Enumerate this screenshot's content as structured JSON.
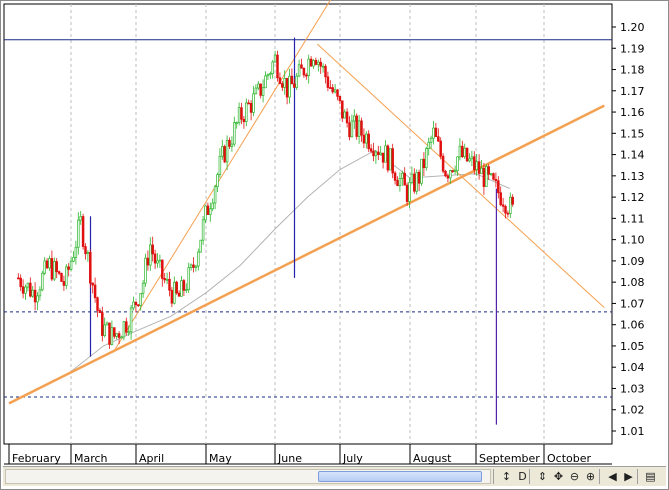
{
  "chart_data": {
    "type": "candlestick",
    "y_axis": {
      "position": "right",
      "min": 1.0,
      "max": 1.21,
      "tick_labels": [
        "1.20",
        "1.19",
        "1.18",
        "1.17",
        "1.16",
        "1.15",
        "1.14",
        "1.13",
        "1.12",
        "1.11",
        "1.10",
        "1.09",
        "1.08",
        "1.07",
        "1.06",
        "1.05",
        "1.04",
        "1.03",
        "1.02",
        "1.01"
      ]
    },
    "x_axis": {
      "months": [
        "February",
        "March",
        "April",
        "May",
        "June",
        "July",
        "August",
        "September",
        "October"
      ],
      "x_range_months": [
        0.15,
        9.0
      ]
    },
    "grid": "vertical dashed at month starts",
    "series": [
      {
        "kind": "price",
        "up_color": "#2ab52a",
        "down_color": "#e01010",
        "points": [
          {
            "t": 0.15,
            "c": 1.082
          },
          {
            "t": 0.4,
            "c": 1.075
          },
          {
            "t": 0.65,
            "c": 1.088
          },
          {
            "t": 0.9,
            "c": 1.079
          },
          {
            "t": 1.15,
            "c": 1.108
          },
          {
            "t": 1.3,
            "c": 1.085
          },
          {
            "t": 1.45,
            "c": 1.06
          },
          {
            "t": 1.65,
            "c": 1.054
          },
          {
            "t": 1.9,
            "c": 1.063
          },
          {
            "t": 2.1,
            "c": 1.08
          },
          {
            "t": 2.2,
            "c": 1.098
          },
          {
            "t": 2.3,
            "c": 1.087
          },
          {
            "t": 2.45,
            "c": 1.078
          },
          {
            "t": 2.6,
            "c": 1.072
          },
          {
            "t": 2.8,
            "c": 1.085
          },
          {
            "t": 3.0,
            "c": 1.112
          },
          {
            "t": 3.25,
            "c": 1.14
          },
          {
            "t": 3.5,
            "c": 1.158
          },
          {
            "t": 3.75,
            "c": 1.168
          },
          {
            "t": 4.0,
            "c": 1.185
          },
          {
            "t": 4.2,
            "c": 1.17
          },
          {
            "t": 4.4,
            "c": 1.178
          },
          {
            "t": 4.6,
            "c": 1.189
          },
          {
            "t": 4.85,
            "c": 1.172
          },
          {
            "t": 5.1,
            "c": 1.155
          },
          {
            "t": 5.4,
            "c": 1.148
          },
          {
            "t": 5.7,
            "c": 1.138
          },
          {
            "t": 5.95,
            "c": 1.122
          },
          {
            "t": 6.15,
            "c": 1.13
          },
          {
            "t": 6.35,
            "c": 1.15
          },
          {
            "t": 6.55,
            "c": 1.132
          },
          {
            "t": 6.75,
            "c": 1.14
          },
          {
            "t": 7.0,
            "c": 1.134
          },
          {
            "t": 7.25,
            "c": 1.125
          },
          {
            "t": 7.4,
            "c": 1.12
          },
          {
            "t": 7.55,
            "c": 1.113
          }
        ]
      },
      {
        "kind": "moving-average",
        "color": "#b4b4b4",
        "points": [
          {
            "t": 1.0,
            "y": 1.038
          },
          {
            "t": 1.5,
            "y": 1.05
          },
          {
            "t": 2.0,
            "y": 1.057
          },
          {
            "t": 2.5,
            "y": 1.064
          },
          {
            "t": 3.0,
            "y": 1.075
          },
          {
            "t": 3.5,
            "y": 1.088
          },
          {
            "t": 4.0,
            "y": 1.105
          },
          {
            "t": 4.5,
            "y": 1.12
          },
          {
            "t": 5.0,
            "y": 1.133
          },
          {
            "t": 5.5,
            "y": 1.142
          },
          {
            "t": 6.0,
            "y": 1.129
          },
          {
            "t": 6.5,
            "y": 1.13
          },
          {
            "t": 7.0,
            "y": 1.131
          },
          {
            "t": 7.5,
            "y": 1.124
          }
        ]
      }
    ],
    "trend_lines": [
      {
        "from": {
          "t": 0.0,
          "y": 1.023
        },
        "to": {
          "t": 9.9,
          "y": 1.163
        },
        "color": "#f5a050",
        "width": 2.5
      },
      {
        "from": {
          "t": 1.65,
          "y": 1.047
        },
        "to": {
          "t": 5.0,
          "y": 1.22
        },
        "color": "#f5a050",
        "width": 1
      },
      {
        "from": {
          "t": 4.65,
          "y": 1.192
        },
        "to": {
          "t": 9.9,
          "y": 1.068
        },
        "color": "#f5a050",
        "width": 1
      }
    ],
    "horizontal_lines": [
      {
        "y": 1.194,
        "color": "#1a2a80",
        "style": "solid"
      },
      {
        "y": 1.066,
        "color": "#1a2a80",
        "style": "dashed"
      },
      {
        "y": 1.026,
        "color": "#1a2a80",
        "style": "dashed"
      }
    ],
    "vertical_markers": [
      {
        "t": 1.3,
        "from": 1.045,
        "to": 1.111,
        "color": "#2222aa"
      },
      {
        "t": 4.3,
        "from": 1.082,
        "to": 1.195,
        "color": "#2222aa"
      },
      {
        "t": 7.3,
        "from": 1.013,
        "to": 1.124,
        "color": "#5522aa"
      }
    ]
  },
  "toolbar": {
    "buttons": [
      {
        "name": "autoscale-icon",
        "glyph": "↕"
      },
      {
        "name": "d-icon",
        "glyph": "D"
      },
      {
        "name": "move-vertical-icon",
        "glyph": "⇕"
      },
      {
        "name": "move-all-icon",
        "glyph": "✥"
      },
      {
        "name": "zoom-out-icon",
        "glyph": "⊖"
      },
      {
        "name": "zoom-in-icon",
        "glyph": "⊕"
      },
      {
        "name": "scroll-left-icon",
        "glyph": "◀"
      },
      {
        "name": "scroll-right-icon",
        "glyph": "▶"
      },
      {
        "name": "menu-icon",
        "glyph": "▤"
      }
    ]
  }
}
